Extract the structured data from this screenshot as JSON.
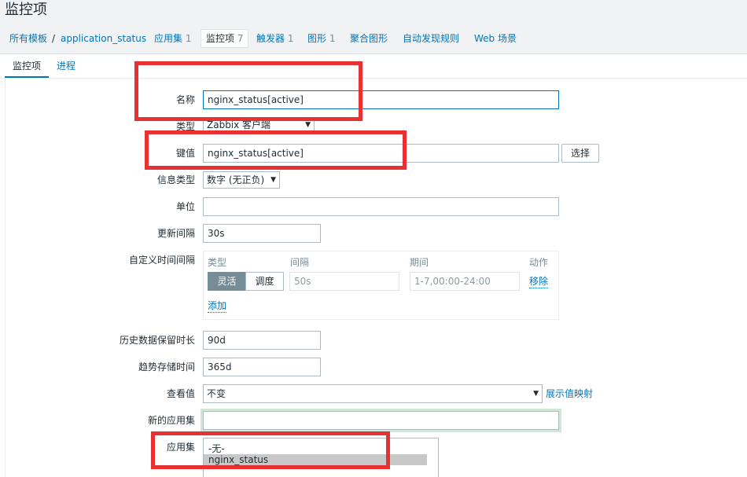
{
  "page": {
    "title": "监控项"
  },
  "breadcrumb": {
    "all_templates": "所有模板",
    "separator": "/",
    "template": "application_status",
    "apps": "应用集",
    "apps_count": "1",
    "items": "监控项",
    "items_count": "7",
    "triggers": "触发器",
    "triggers_count": "1",
    "graphs": "图形",
    "graphs_count": "1",
    "screens": "聚合图形",
    "discovery": "自动发现规则",
    "web": "Web 场景"
  },
  "tabs": {
    "item": "监控项",
    "process": "进程"
  },
  "form": {
    "name_label": "名称",
    "name_value": "nginx_status[active]",
    "type_label": "类型",
    "type_value": "Zabbix 客户端",
    "key_label": "键值",
    "key_value": "nginx_status[active]",
    "key_select_button": "选择",
    "info_type_label": "信息类型",
    "info_type_value": "数字 (无正负)",
    "units_label": "单位",
    "units_value": "",
    "update_interval_label": "更新间隔",
    "update_interval_value": "30s",
    "custom_intervals_label": "自定义时间间隔",
    "custom_intervals": {
      "col_type": "类型",
      "col_interval": "间隔",
      "col_period": "期间",
      "col_action": "动作",
      "flexible": "灵活",
      "scheduling": "调度",
      "interval_value": "50s",
      "period_value": "1-7,00:00-24:00",
      "remove": "移除",
      "add": "添加"
    },
    "history_label": "历史数据保留时长",
    "history_value": "90d",
    "trends_label": "趋势存储时间",
    "trends_value": "365d",
    "show_value_label": "查看值",
    "show_value_value": "不变",
    "show_value_mappings": "展示值映射",
    "new_app_label": "新的应用集",
    "new_app_value": "",
    "apps_label": "应用集",
    "apps_options": [
      "-无-",
      "nginx_status"
    ]
  },
  "colors": {
    "accent": "#0275b8",
    "highlight_box": "#e63232",
    "segment_active": "#768d99"
  }
}
